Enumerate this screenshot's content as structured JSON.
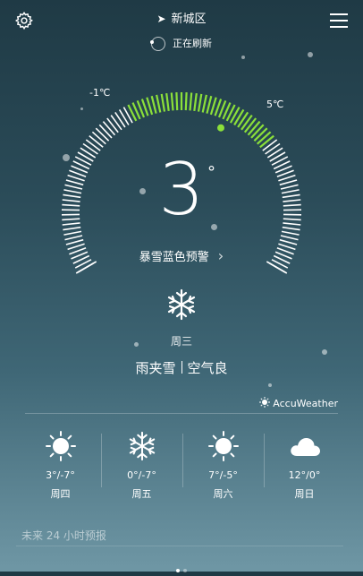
{
  "header": {
    "location": "新城区",
    "refresh_status": "正在刷新"
  },
  "dial": {
    "min_label": "-1℃",
    "max_label": "5℃",
    "current_temp": "3",
    "degree_symbol": "°",
    "accent_color": "#8be03a"
  },
  "alert": {
    "text": "暴雪蓝色预警",
    "chevron": "›"
  },
  "today": {
    "icon": "snowflake-icon",
    "weekday": "周三",
    "condition": "雨夹雪",
    "air_quality": "空气良"
  },
  "provider": {
    "name": "AccuWeather",
    "icon": "accuweather-icon"
  },
  "forecast": [
    {
      "icon": "sun-icon",
      "temp": "3°/-7°",
      "day": "周四"
    },
    {
      "icon": "snowflake-icon",
      "temp": "0°/-7°",
      "day": "周五"
    },
    {
      "icon": "sun-icon",
      "temp": "7°/-5°",
      "day": "周六"
    },
    {
      "icon": "cloud-icon",
      "temp": "12°/0°",
      "day": "周日"
    }
  ],
  "hourly": {
    "label": "未来 24 小时预报"
  },
  "pager": {
    "pages": 2,
    "active": 0
  }
}
